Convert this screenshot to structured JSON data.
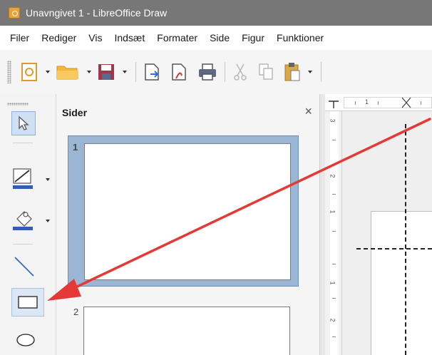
{
  "window": {
    "title": "Unavngivet 1 - LibreOffice Draw"
  },
  "menu": {
    "items": [
      "Filer",
      "Rediger",
      "Vis",
      "Indsæt",
      "Formater",
      "Side",
      "Figur",
      "Funktioner"
    ]
  },
  "toolbar": {
    "icons": [
      "templates-icon",
      "open-folder-icon",
      "save-icon",
      "export-icon",
      "export-pdf-icon",
      "print-icon",
      "cut-icon",
      "copy-icon",
      "paste-icon"
    ]
  },
  "draw_toolbar": {
    "icons": [
      "select-arrow-icon",
      "line-color-icon",
      "fill-color-icon",
      "line-tool-icon",
      "rectangle-tool-icon",
      "ellipse-tool-icon"
    ],
    "line_color": "#2f5fb3",
    "fill_color": "#2f5fb3"
  },
  "slides_panel": {
    "title": "Sider",
    "close_glyph": "×",
    "slides": [
      {
        "number": "1",
        "selected": true
      },
      {
        "number": "2",
        "selected": false
      }
    ]
  },
  "ruler": {
    "top_numbers": [
      "1"
    ],
    "left_numbers": [
      "3",
      "2",
      "1",
      "1",
      "2"
    ]
  },
  "annotation": {
    "color": "#e53935",
    "points_to": "rectangle-tool-icon"
  }
}
